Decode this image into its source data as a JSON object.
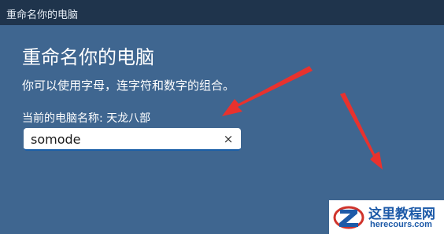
{
  "window": {
    "title": "重命名你的电脑"
  },
  "dialog": {
    "heading": "重命名你的电脑",
    "description": "你可以使用字母，连字符和数字的组合。",
    "current_name": "当前的电脑名称: 天龙八部",
    "name_input": {
      "value": "somode"
    },
    "clear_icon": "×"
  },
  "watermark": {
    "title": "这里教程网",
    "url": "herecours.com"
  },
  "colors": {
    "background": "#3f6690",
    "titlebar": "#1f344c",
    "annotation_arrow": "#e8322e",
    "watermark_text": "#1d5aa8"
  }
}
